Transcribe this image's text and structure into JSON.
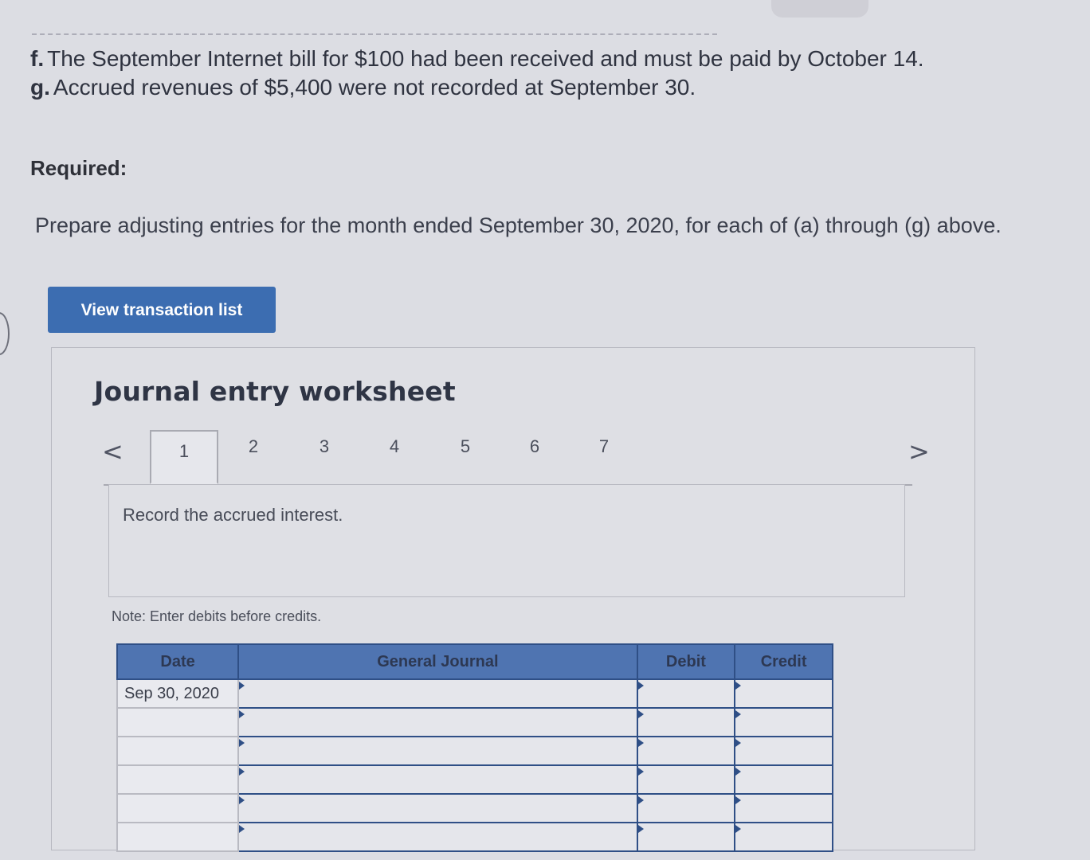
{
  "problem": {
    "item_f": {
      "letter": "f.",
      "text": "The September Internet bill for $100 had been received and must be paid by October 14."
    },
    "item_g": {
      "letter": "g.",
      "text": "Accrued revenues of $5,400 were not recorded at September 30."
    },
    "required_label": "Required:",
    "instruction": "Prepare adjusting entries for the month ended September 30, 2020, for each of (a) through (g) above."
  },
  "view_button_label": "View transaction list",
  "worksheet": {
    "title": "Journal entry worksheet",
    "prev_icon": "chevron-left-icon",
    "next_icon": "chevron-right-icon",
    "prev_glyph": "<",
    "next_glyph": ">",
    "tabs": [
      "1",
      "2",
      "3",
      "4",
      "5",
      "6",
      "7"
    ],
    "active_tab": "1",
    "prompt": "Record the accrued interest.",
    "note": "Note: Enter debits before credits."
  },
  "journal_table": {
    "headers": {
      "date": "Date",
      "general_journal": "General Journal",
      "debit": "Debit",
      "credit": "Credit"
    },
    "rows": [
      {
        "date": "Sep 30, 2020",
        "account": "",
        "debit": "",
        "credit": ""
      },
      {
        "date": "",
        "account": "",
        "debit": "",
        "credit": ""
      },
      {
        "date": "",
        "account": "",
        "debit": "",
        "credit": ""
      },
      {
        "date": "",
        "account": "",
        "debit": "",
        "credit": ""
      },
      {
        "date": "",
        "account": "",
        "debit": "",
        "credit": ""
      },
      {
        "date": "",
        "account": "",
        "debit": "",
        "credit": ""
      }
    ]
  },
  "colors": {
    "button": "#3c6db1",
    "table_header": "#4f74b1",
    "table_border": "#2f4f86"
  }
}
